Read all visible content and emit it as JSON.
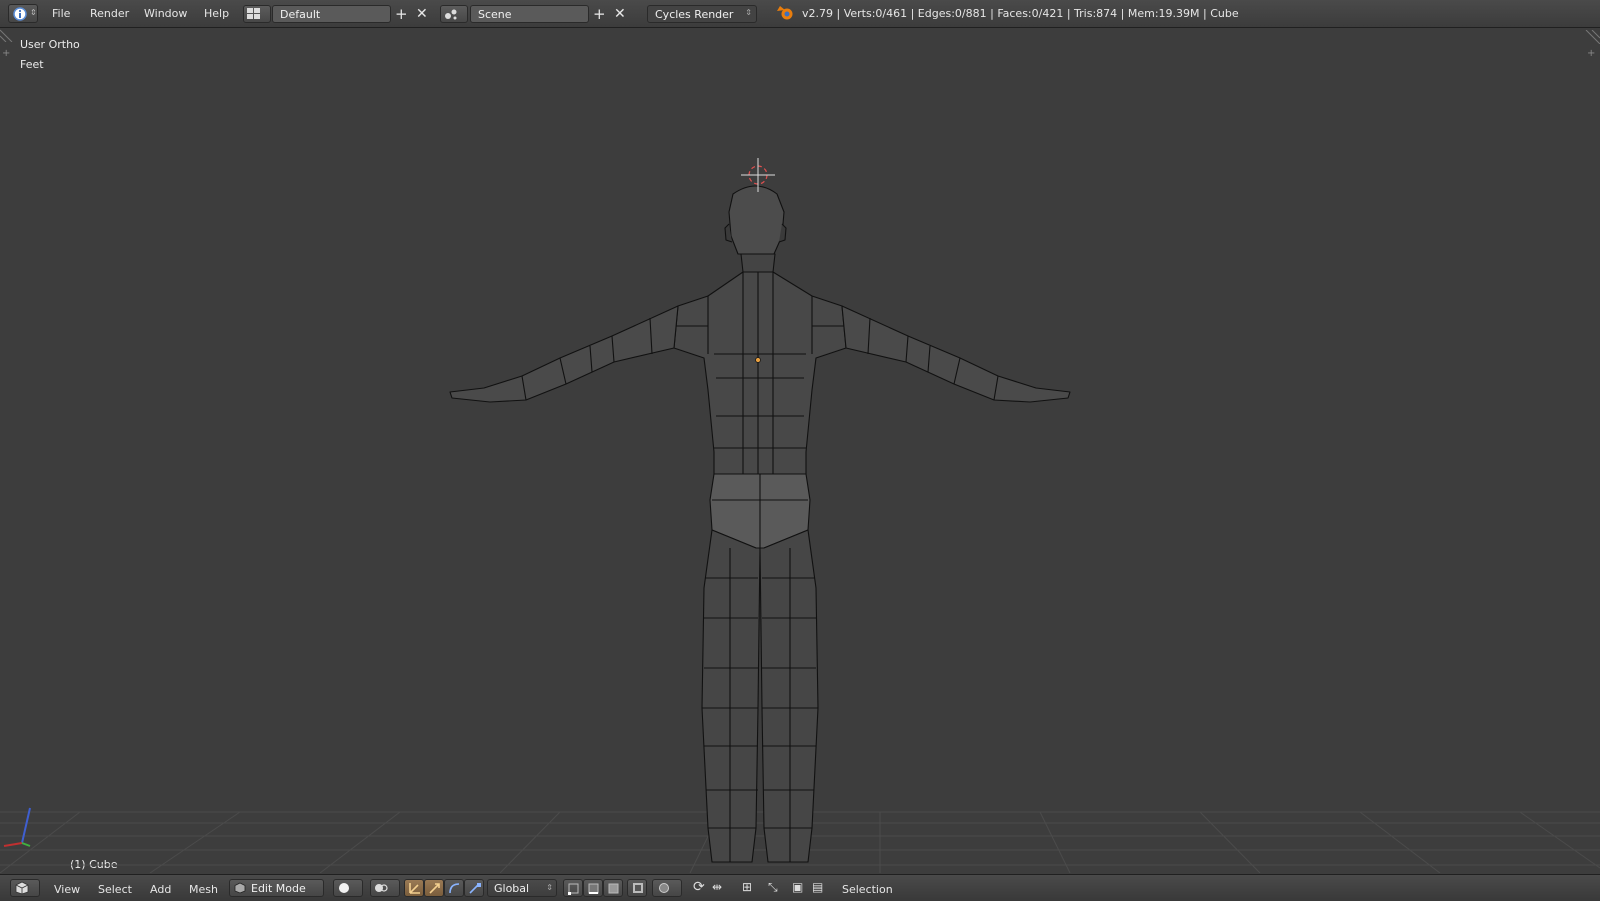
{
  "header": {
    "info_icon": "info-icon",
    "menu": [
      "File",
      "Render",
      "Window",
      "Help"
    ],
    "screen_layout": "Default",
    "scene": "Scene",
    "render_engine": "Cycles Render",
    "stats": "v2.79 | Verts:0/461 | Edges:0/881 | Faces:0/421 | Tris:874 | Mem:19.39M | Cube"
  },
  "viewport": {
    "view_name": "User Ortho",
    "units": "Feet",
    "object_label": "(1) Cube",
    "mesh": "low-poly humanoid in T-pose, edit mode wireframe"
  },
  "view3d_header": {
    "menu": [
      "View",
      "Select",
      "Add",
      "Mesh"
    ],
    "mode": "Edit Mode",
    "pivot": "Global",
    "selection_label": "Selection"
  },
  "colors": {
    "background": "#3d3d3d",
    "mesh_face": "#4a4a4a",
    "mesh_edge": "#111111",
    "accent": "#e8a040"
  }
}
